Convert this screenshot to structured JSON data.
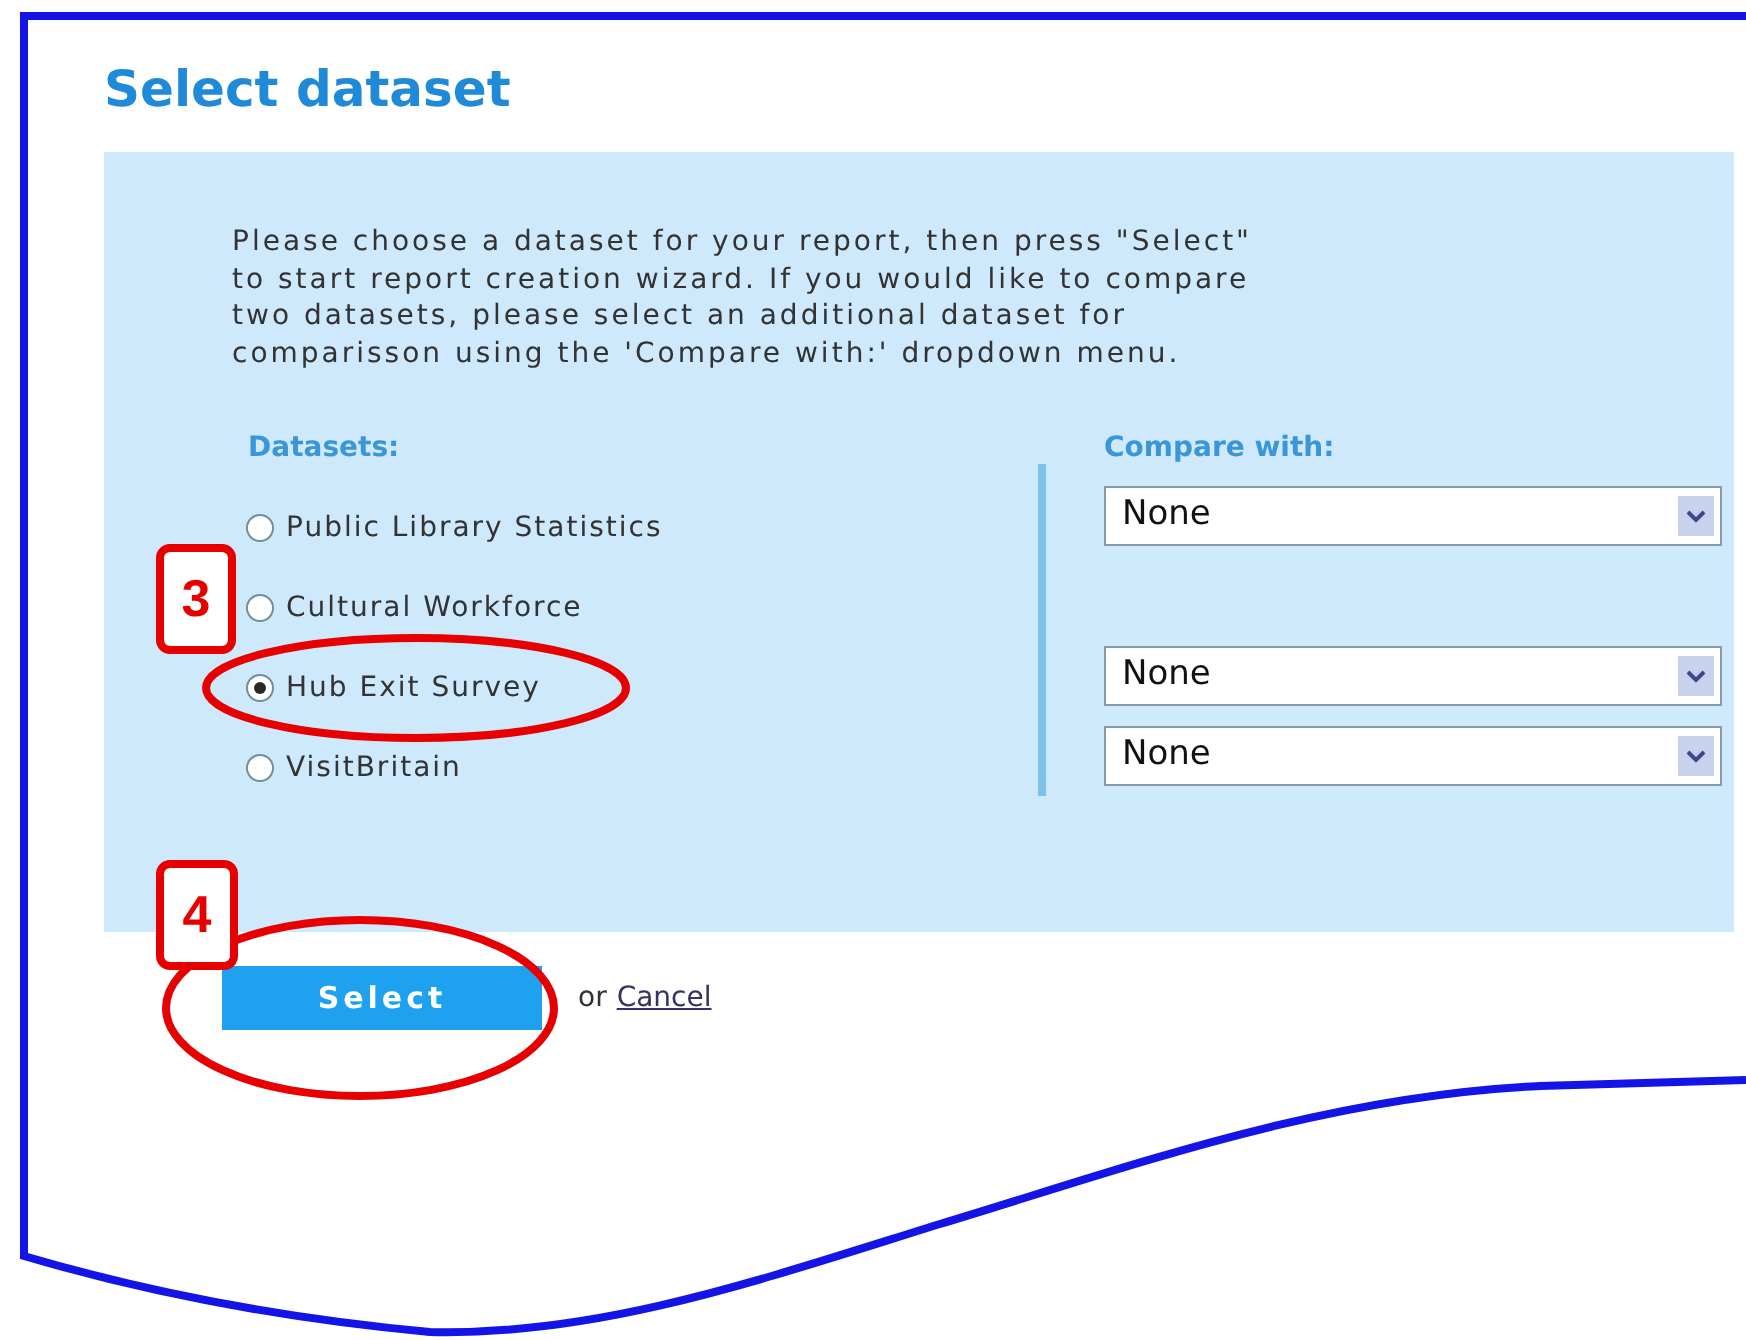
{
  "title": "Select dataset",
  "intro": "Please choose a dataset for your report, then press \"Select\" to start report creation wizard. If you would like to compare two datasets, please select an additional dataset for comparisson using the 'Compare with:' dropdown menu.",
  "datasets_label": "Datasets:",
  "compare_label": "Compare with:",
  "datasets": [
    {
      "label": "Public Library Statistics",
      "selected": false,
      "compare": "None"
    },
    {
      "label": "Cultural Workforce",
      "selected": false
    },
    {
      "label": "Hub Exit Survey",
      "selected": true,
      "compare": "None"
    },
    {
      "label": "VisitBritain",
      "selected": false,
      "compare": "None"
    }
  ],
  "select_button": "Select",
  "or_text": "or",
  "cancel_link": "Cancel",
  "callouts": [
    {
      "number": "3"
    },
    {
      "number": "4"
    }
  ]
}
